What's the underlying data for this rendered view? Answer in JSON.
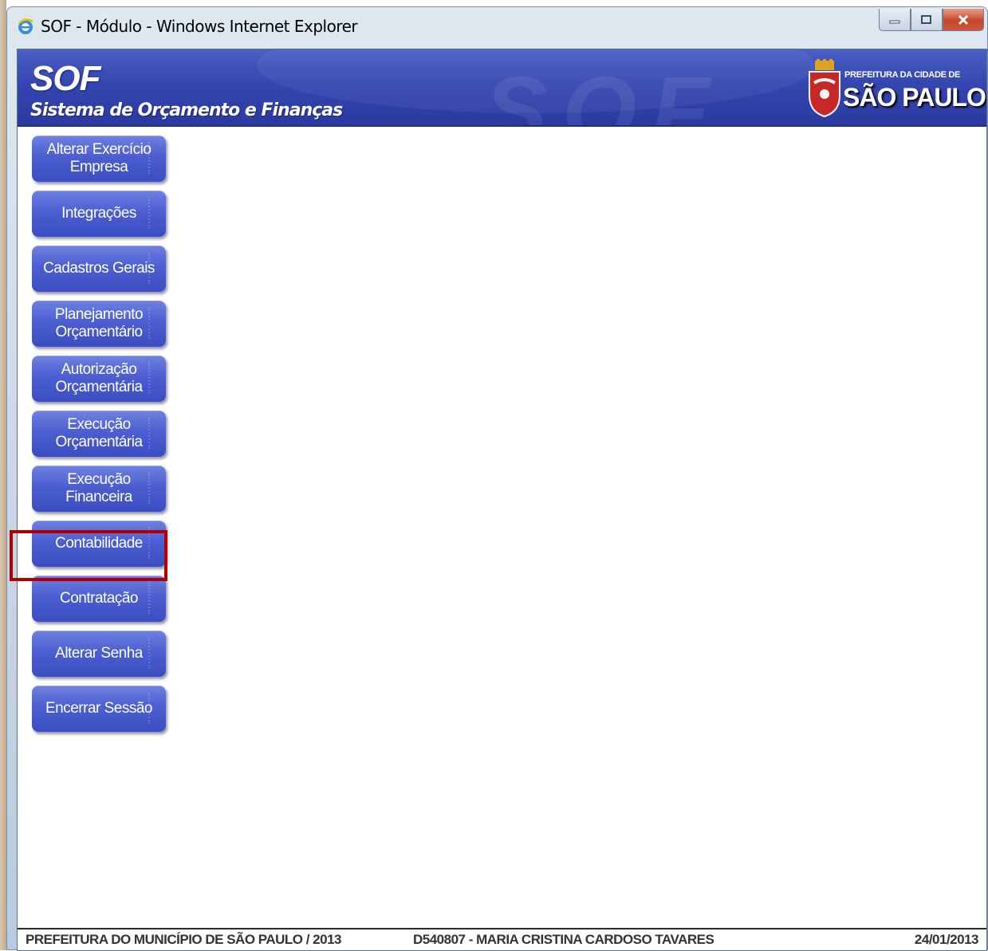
{
  "window": {
    "title": "SOF - Módulo - Windows Internet Explorer"
  },
  "header": {
    "app_name": "SOF",
    "subtitle": "Sistema de Orçamento e Finanças",
    "watermark": "SOF",
    "org_small": "PREFEITURA DA CIDADE DE",
    "org_big": "SÃO PAULO"
  },
  "menu": {
    "items": [
      {
        "label": "Alterar Exercício Empresa"
      },
      {
        "label": "Integrações"
      },
      {
        "label": "Cadastros Gerais"
      },
      {
        "label": "Planejamento Orçamentário"
      },
      {
        "label": "Autorização Orçamentária"
      },
      {
        "label": "Execução Orçamentária"
      },
      {
        "label": "Execução Financeira"
      },
      {
        "label": "Contabilidade"
      },
      {
        "label": "Contratação"
      },
      {
        "label": "Alterar Senha"
      },
      {
        "label": "Encerrar Sessão"
      }
    ],
    "highlighted": "Contratação"
  },
  "status": {
    "org": "PREFEITURA DO MUNICÍPIO DE SÃO PAULO / 2013",
    "user": "D540807 - MARIA CRISTINA CARDOSO TAVARES",
    "date": "24/01/2013"
  },
  "colors": {
    "banner": "#3546b0",
    "button": "#4b5fd2",
    "highlight": "#b00000"
  }
}
